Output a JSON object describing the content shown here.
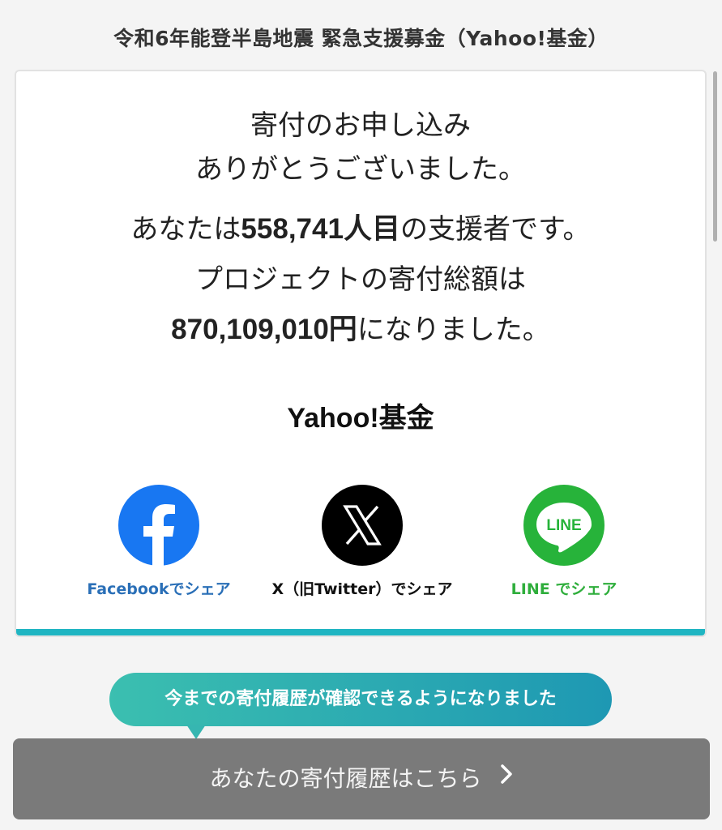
{
  "header": {
    "title": "令和6年能登半島地震 緊急支援募金（Yahoo!基金）"
  },
  "card": {
    "thanks_line1": "寄付のお申し込み",
    "thanks_line2": "ありがとうございました。",
    "supporter_prefix": "あなたは",
    "supporter_count": "558,741人目",
    "supporter_suffix": "の支援者です。",
    "total_intro": "プロジェクトの寄付総額は",
    "total_amount": "870,109,010円",
    "total_suffix": "になりました。",
    "brand": "Yahoo!基金"
  },
  "share": {
    "facebook_label": "Facebookでシェア",
    "x_label": "X（旧Twitter）でシェア",
    "line_label": "LINE でシェア",
    "line_icon_text": "LINE"
  },
  "notice": {
    "bubble_text": "今までの寄付履歴が確認できるようになりました"
  },
  "cta": {
    "history_label": "あなたの寄付履歴はこちら"
  },
  "colors": {
    "accent": "#1fb5c2",
    "facebook": "#1877f2",
    "x": "#000000",
    "line": "#27b33a",
    "button_bg": "#7a7a7a"
  },
  "icons": {
    "facebook": "facebook-icon",
    "x": "x-icon",
    "line": "line-icon",
    "chevron": "chevron-right-icon"
  }
}
